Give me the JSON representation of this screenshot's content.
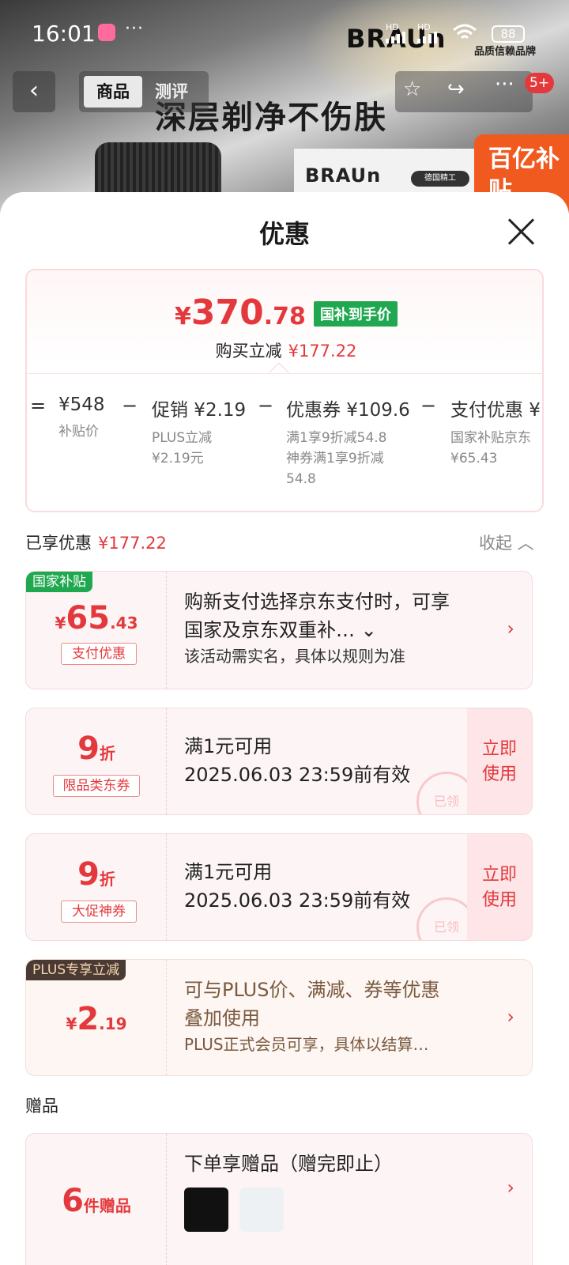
{
  "status_bar": {
    "time": "16:01",
    "more": "···",
    "hd1": "HD",
    "hd2": "HD",
    "battery": "88"
  },
  "background": {
    "brand": "BRAUn",
    "brand_sub": "品质信赖品牌",
    "headline": "深层剃净不伤肤",
    "card_brand": "BRAUn",
    "card_badge": "德国精工",
    "promo": "百亿补贴"
  },
  "nav": {
    "tabs": [
      {
        "label": "商品",
        "active": true
      },
      {
        "label": "测评",
        "active": false
      }
    ],
    "badge": "5+"
  },
  "sheet": {
    "title": "优惠",
    "summary": {
      "price_currency": "¥",
      "price_int": "370",
      "price_dec": ".78",
      "price_tag": "国补到手价",
      "reduce_label": "购买立减",
      "reduce_value": "¥177.22",
      "breakdown": [
        {
          "op": "=",
          "label": "¥548",
          "sub": [
            "补贴价"
          ]
        },
        {
          "op": "−",
          "label": "促销 ¥2.19",
          "sub": [
            "PLUS立减",
            "¥2.19元"
          ]
        },
        {
          "op": "−",
          "label": "优惠券 ¥109.6",
          "sub": [
            "满1享9折减54.8",
            "神券满1享9折减",
            "54.8"
          ]
        },
        {
          "op": "−",
          "label": "支付优惠 ¥",
          "sub": [
            "国家补贴京东",
            "¥65.43"
          ]
        }
      ]
    },
    "enjoyed_label": "已享优惠",
    "enjoyed_value": "¥177.22",
    "collapse_label": "收起 ︿",
    "cards": [
      {
        "tag": "国家补贴",
        "amount_cur": "¥",
        "amount_big": "65",
        "amount_sm": ".43",
        "sublabel": "支付优惠",
        "line1": "购新支付选择京东支付时，可享",
        "line2": "国家及京东双重补… ⌄",
        "line3": "该活动需实名，具体以规则为准",
        "arrow": "›"
      },
      {
        "amount_big": "9",
        "amount_sm": "折",
        "sublabel": "限品类东券",
        "line1": "满1元可用",
        "line2": "2025.06.03  23:59前有效",
        "use": [
          "立即",
          "使用"
        ],
        "stamp": "已领"
      },
      {
        "amount_big": "9",
        "amount_sm": "折",
        "sublabel": "大促神券",
        "line1": "满1元可用",
        "line2": "2025.06.03  23:59前有效",
        "use": [
          "立即",
          "使用"
        ],
        "stamp": "已领"
      },
      {
        "tag": "PLUS专享立减",
        "amount_cur": "¥",
        "amount_big": "2",
        "amount_sm": ".19",
        "line1": "可与PLUS价、满减、券等优惠",
        "line2": "叠加使用",
        "line3": "PLUS正式会员可享，具体以结算…",
        "arrow": "›"
      }
    ],
    "gift_section_title": "赠品",
    "gift_card": {
      "amount_big": "6",
      "amount_sm": "件赠品",
      "line1": "下单享赠品（赠完即止）",
      "arrow": "›"
    }
  },
  "icons": [
    "back-icon",
    "star-icon",
    "share-icon",
    "more-icon",
    "close-icon",
    "chevron-up-icon",
    "chevron-right-icon",
    "wifi-icon",
    "battery-icon"
  ],
  "colors": {
    "accent_red": "#e4393c",
    "guobu_green": "#1fa84f",
    "plus_dark": "#4a3a33"
  }
}
